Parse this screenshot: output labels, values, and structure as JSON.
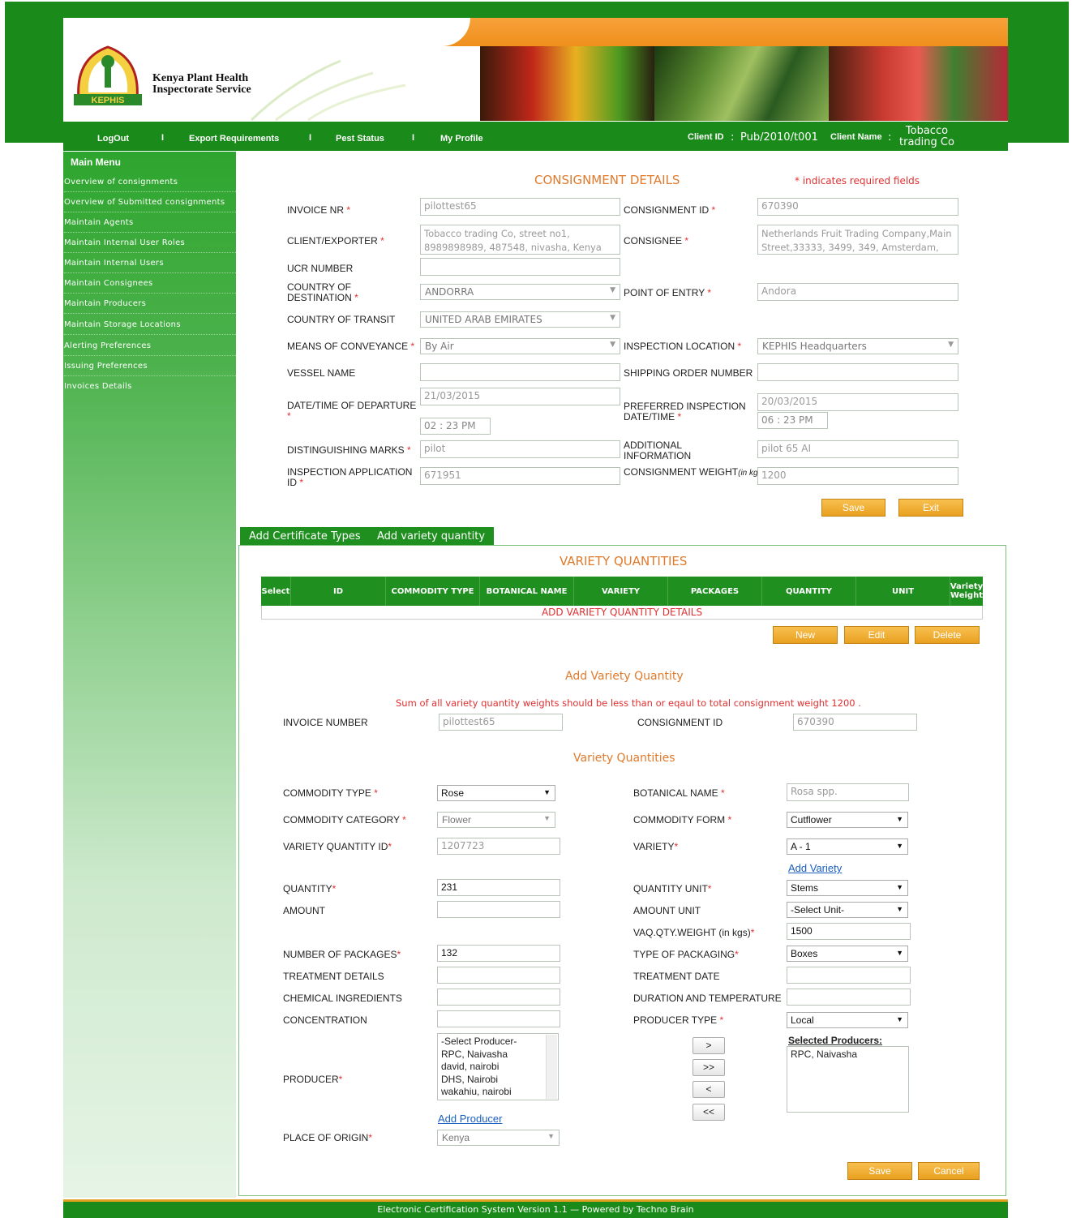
{
  "header": {
    "org_name_line1": "Kenya Plant Health",
    "org_name_line2": "Inspectorate Service",
    "logo_text": "KEPHIS"
  },
  "nav": {
    "logout": "LogOut",
    "export_requirements": "Export Requirements",
    "pest_status": "Pest Status",
    "my_profile": "My Profile",
    "separator": "I",
    "client_id_label": "Client ID",
    "client_id_colon": ":",
    "client_id_value": "Pub/2010/t001",
    "client_name_label": "Client Name",
    "client_name_colon": ":",
    "client_name_line1": "Tobacco",
    "client_name_line2": "trading Co"
  },
  "sidebar": {
    "title": "Main Menu",
    "items": [
      "Overview of consignments",
      "Overview of Submitted consignments",
      "Maintain Agents",
      "Maintain Internal User Roles",
      "Maintain Internal Users",
      "Maintain Consignees",
      "Maintain Producers",
      "Maintain Storage Locations",
      "Alerting Preferences",
      "Issuing Preferences",
      "Invoices Details"
    ]
  },
  "consignment": {
    "title": "CONSIGNMENT DETAILS",
    "required_note": "* indicates required fields",
    "star": "*",
    "invoice_nr_label": "INVOICE NR",
    "invoice_nr": "pilottest65",
    "consignment_id_label": "CONSIGNMENT ID",
    "consignment_id": "670390",
    "client_exporter_label": "CLIENT/EXPORTER",
    "client_exporter_line1": "Tobacco trading Co, street no1,",
    "client_exporter_line2": "8989898989, 487548, nivasha, Kenya",
    "consignee_label": "CONSIGNEE",
    "consignee_line1": "Netherlands Fruit Trading Company,Main",
    "consignee_line2": "Street,33333, 3499, 349, Amsterdam,",
    "ucr_label": "UCR NUMBER",
    "ucr": "",
    "country_dest_label1": "COUNTRY OF",
    "country_dest_label2": "DESTINATION",
    "country_dest": "ANDORRA",
    "point_of_entry_label": "POINT OF ENTRY",
    "point_of_entry": "Andora",
    "country_transit_label": "COUNTRY OF TRANSIT",
    "country_transit": "UNITED ARAB EMIRATES",
    "conveyance_label": "MEANS OF CONVEYANCE",
    "conveyance": "By Air",
    "inspection_location_label": "INSPECTION LOCATION",
    "inspection_location": "KEPHIS Headquarters",
    "vessel_label": "VESSEL NAME",
    "vessel": "",
    "shipping_order_label": "SHIPPING ORDER NUMBER",
    "shipping_order": "",
    "departure_label": "DATE/TIME OF DEPARTURE",
    "departure_date": "21/03/2015",
    "departure_time": "02 : 23 PM",
    "pref_insp_label1": "PREFERRED INSPECTION",
    "pref_insp_label2": "DATE/TIME",
    "pref_insp_date": "20/03/2015",
    "pref_insp_time": "06 : 23 PM",
    "marks_label": "DISTINGUISHING MARKS",
    "marks": "pilot",
    "additional_label1": "ADDITIONAL",
    "additional_label2": "INFORMATION",
    "additional": "pilot 65 AI",
    "app_id_label1": "INSPECTION APPLICATION",
    "app_id_label2": "ID",
    "app_id": "671951",
    "weight_label": "CONSIGNMENT WEIGHT",
    "weight_unit": "(in kgs)",
    "weight": "1200",
    "save": "Save",
    "exit": "Exit"
  },
  "tabs": [
    "Add Certificate Types",
    "Add variety quantity"
  ],
  "variety_table": {
    "title": "VARIETY QUANTITIES",
    "columns": [
      "Select",
      "ID",
      "COMMODITY TYPE",
      "BOTANICAL NAME",
      "VARIETY",
      "PACKAGES",
      "QUANTITY",
      "UNIT",
      "Variety Weight"
    ],
    "empty_text": "ADD VARIETY QUANTITY DETAILS",
    "new": "New",
    "edit": "Edit",
    "delete": "Delete"
  },
  "add_variety": {
    "title": "Add Variety Quantity",
    "warning": "Sum of all variety quantity weights should be less than or eqaul to total consignment weight 1200 .",
    "invoice_number_label": "INVOICE NUMBER",
    "invoice_number": "pilottest65",
    "consignment_id_label": "CONSIGNMENT ID",
    "consignment_id": "670390",
    "subtitle": "Variety Quantities",
    "commodity_type_label": "COMMODITY TYPE",
    "commodity_type": "Rose",
    "botanical_name_label": "BOTANICAL NAME",
    "botanical_name": "Rosa spp.",
    "commodity_category_label": "COMMODITY CATEGORY",
    "commodity_category": "Flower",
    "commodity_form_label": "COMMODITY FORM",
    "commodity_form": "Cutflower",
    "vq_id_label": "VARIETY QUANTITY ID",
    "vq_id": "1207723",
    "variety_label": "VARIETY",
    "variety": "A - 1",
    "add_variety_link": "Add Variety",
    "quantity_label": "QUANTITY",
    "quantity": "231",
    "quantity_unit_label": "QUANTITY UNIT",
    "quantity_unit": "Stems",
    "amount_label": "AMOUNT",
    "amount": "",
    "amount_unit_label": "AMOUNT UNIT",
    "amount_unit": "-Select Unit-",
    "vaq_weight_label": "VAQ.QTY.WEIGHT (in kgs)",
    "vaq_weight": "1500",
    "packages_label": "NUMBER OF PACKAGES",
    "packages": "132",
    "packaging_type_label": "TYPE OF PACKAGING",
    "packaging_type": "Boxes",
    "treatment_details_label": "TREATMENT DETAILS",
    "treatment_date_label": "TREATMENT DATE",
    "chemical_label": "CHEMICAL INGREDIENTS",
    "duration_label": "DURATION AND TEMPERATURE",
    "concentration_label": "CONCENTRATION",
    "producer_type_label": "PRODUCER TYPE",
    "producer_type": "Local",
    "producer_label": "PRODUCER",
    "producers": [
      "-Select Producer-",
      "RPC, Naivasha",
      "david, nairobi",
      "DHS, Nairobi",
      "wakahiu, nairobi"
    ],
    "move_buttons": [
      ">",
      ">>",
      "<",
      "<<"
    ],
    "selected_producers_label": "Selected Producers:",
    "selected_producers": [
      "RPC, Naivasha"
    ],
    "add_producer_link": "Add Producer",
    "place_of_origin_label": "PLACE OF ORIGIN",
    "place_of_origin": "Kenya",
    "save": "Save",
    "cancel": "Cancel"
  },
  "footer": {
    "text": "Electronic Certification System Version 1.1 — Powered by Techno Brain"
  }
}
